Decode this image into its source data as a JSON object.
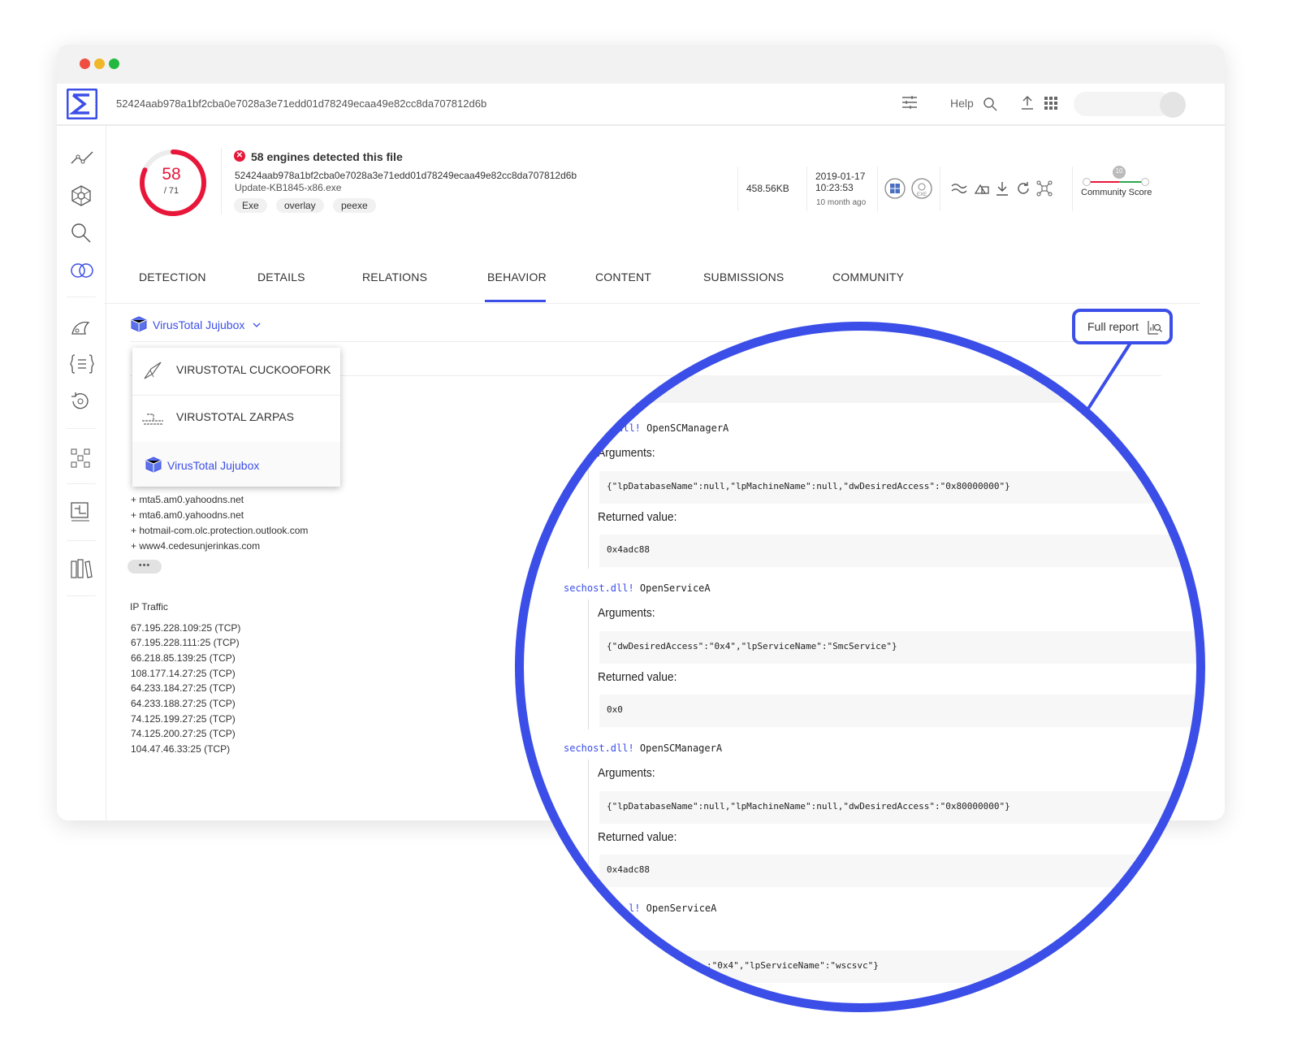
{
  "app": {
    "hash": "52424aab978a1bf2cba0e7028a3e71edd01d78249ecaa49e82cc8da707812d6b",
    "help_label": "Help"
  },
  "summary": {
    "score": "58",
    "total": "/ 71",
    "title": "58 engines detected this file",
    "hash": "52424aab978a1bf2cba0e7028a3e71edd01d78249ecaa49e82cc8da707812d6b",
    "filename": "Update-KB1845-x86.exe",
    "tags": [
      "Exe",
      "overlay",
      "peexe"
    ],
    "size": "458.56KB",
    "date": "2019-01-17",
    "time": "10:23:53",
    "age": "10 month ago",
    "community_label": "Community Score",
    "community_value": "10",
    "detection_ratio": 0.817
  },
  "tabs": [
    "DETECTION",
    "DETAILS",
    "RELATIONS",
    "BEHAVIOR",
    "CONTENT",
    "SUBMISSIONS",
    "COMMUNITY"
  ],
  "active_tab": "BEHAVIOR",
  "sandbox": {
    "selected": "VirusTotal Jujubox",
    "options": [
      "VIRUSTOTAL CUCKOOFORK",
      "VIRUSTOTAL ZARPAS",
      "VirusTotal Jujubox"
    ]
  },
  "full_report_label": "Full report",
  "dns": [
    "+ mta5.am0.yahoodns.net",
    "+ mta6.am0.yahoodns.net",
    "+ hotmail-com.olc.protection.outlook.com",
    "+ www4.cedesunjerinkas.com"
  ],
  "ip_traffic": {
    "title": "IP Traffic",
    "items": [
      "67.195.228.109:25 (TCP)",
      "67.195.228.111:25 (TCP)",
      "66.218.85.139:25 (TCP)",
      "108.177.14.27:25 (TCP)",
      "64.233.184.27:25 (TCP)",
      "64.233.188.27:25 (TCP)",
      "74.125.199.27:25 (TCP)",
      "74.125.200.27:25 (TCP)",
      "104.47.46.33:25 (TCP)"
    ]
  },
  "calls": {
    "arguments_label": "Arguments:",
    "returned_label": "Returned value:",
    "items": [
      {
        "dll": "dll!",
        "func": " OpenSCManagerA",
        "args": "{\"lpDatabaseName\":null,\"lpMachineName\":null,\"dwDesiredAccess\":\"0x80000000\"}",
        "ret": "0x4adc88"
      },
      {
        "dll": "sechost.dll!",
        "func": " OpenServiceA",
        "args": "{\"dwDesiredAccess\":\"0x4\",\"lpServiceName\":\"SmcService\"}",
        "ret": "0x0"
      },
      {
        "dll": "sechost.dll!",
        "func": " OpenSCManagerA",
        "args": "{\"lpDatabaseName\":null,\"lpMachineName\":null,\"dwDesiredAccess\":\"0x80000000\"}",
        "ret": "0x4adc88"
      },
      {
        "dll": "l!",
        "func": " OpenServiceA",
        "args": ":\"0x4\",\"lpServiceName\":\"wscsvc\"}",
        "ret": ""
      }
    ]
  },
  "colors": {
    "accent": "#3b4ee8",
    "danger": "#e8173a"
  }
}
